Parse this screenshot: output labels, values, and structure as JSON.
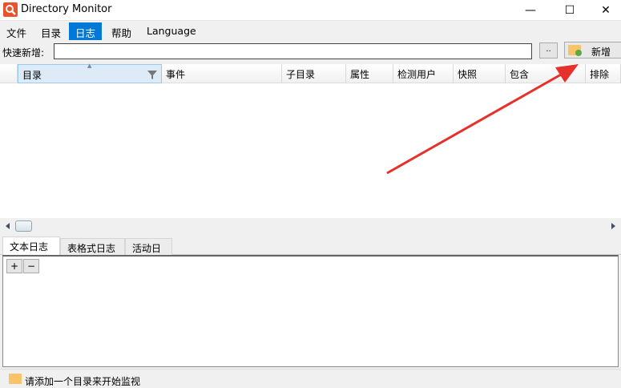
{
  "window": {
    "title": "Directory Monitor",
    "minimize": "—",
    "maximize": "☐",
    "close": "✕"
  },
  "menu": [
    "文件",
    "目录",
    "日志",
    "帮助",
    "Language"
  ],
  "quick_add": {
    "label": "快速新增:",
    "value": "",
    "browse_label": "..",
    "add_label": "新增"
  },
  "grid": {
    "columns": [
      "目录",
      "事件",
      "子目录",
      "属性",
      "检测用户",
      "快照",
      "包含",
      "排除"
    ],
    "sort_indicator": "▲"
  },
  "log_tabs": [
    "文本日志",
    "表格式日志",
    "活动日志"
  ],
  "log_buttons": {
    "expand": "+",
    "collapse": "−"
  },
  "status": "请添加一个目录来开始监视",
  "colors": {
    "accent": "#0078d7",
    "arrow": "#e8302a"
  }
}
